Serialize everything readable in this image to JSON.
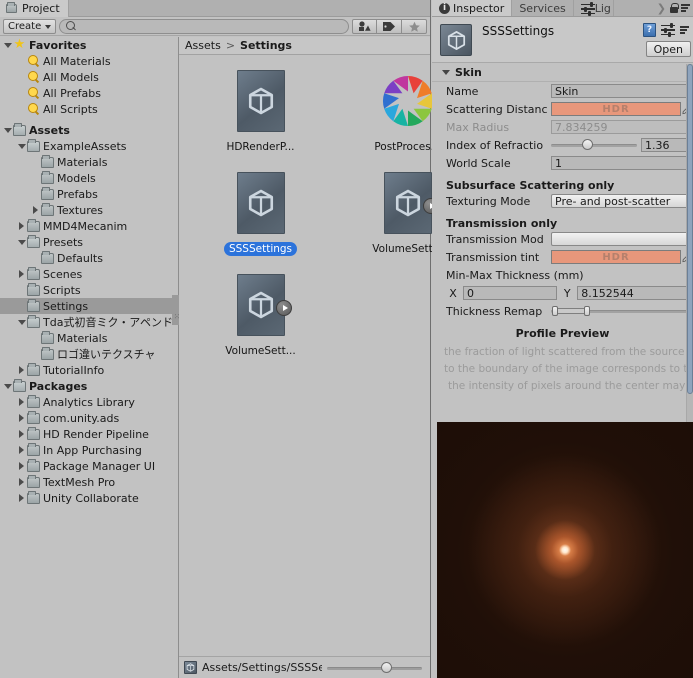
{
  "project_window": {
    "tabs": [
      {
        "label": "Project",
        "icon": "folder-icon",
        "active": true
      }
    ],
    "toolbar": {
      "create_label": "Create",
      "search_placeholder": "",
      "search_value": "",
      "filters": [
        {
          "name": "filter-by-type-icon"
        },
        {
          "name": "filter-by-label-icon"
        },
        {
          "name": "filter-favorites-star-icon"
        }
      ]
    },
    "tree": [
      {
        "label": "Favorites",
        "depth": 0,
        "icon": "star-icon",
        "twisty": "down",
        "bold": true,
        "selected": false
      },
      {
        "label": "All Materials",
        "depth": 1,
        "icon": "search-lens-icon",
        "twisty": "none",
        "bold": false,
        "selected": false
      },
      {
        "label": "All Models",
        "depth": 1,
        "icon": "search-lens-icon",
        "twisty": "none",
        "bold": false,
        "selected": false
      },
      {
        "label": "All Prefabs",
        "depth": 1,
        "icon": "search-lens-icon",
        "twisty": "none",
        "bold": false,
        "selected": false
      },
      {
        "label": "All Scripts",
        "depth": 1,
        "icon": "search-lens-icon",
        "twisty": "none",
        "bold": false,
        "selected": false
      },
      {
        "label": "",
        "depth": 0,
        "icon": "none",
        "twisty": "none",
        "bold": false,
        "selected": false
      },
      {
        "label": "Assets",
        "depth": 0,
        "icon": "folder-icon",
        "twisty": "down",
        "bold": true,
        "selected": false
      },
      {
        "label": "ExampleAssets",
        "depth": 1,
        "icon": "folder-icon",
        "twisty": "down",
        "bold": false,
        "selected": false
      },
      {
        "label": "Materials",
        "depth": 2,
        "icon": "folder-icon",
        "twisty": "none",
        "bold": false,
        "selected": false
      },
      {
        "label": "Models",
        "depth": 2,
        "icon": "folder-icon",
        "twisty": "none",
        "bold": false,
        "selected": false
      },
      {
        "label": "Prefabs",
        "depth": 2,
        "icon": "folder-icon",
        "twisty": "none",
        "bold": false,
        "selected": false
      },
      {
        "label": "Textures",
        "depth": 2,
        "icon": "folder-icon",
        "twisty": "right",
        "bold": false,
        "selected": false
      },
      {
        "label": "MMD4Mecanim",
        "depth": 1,
        "icon": "folder-icon",
        "twisty": "right",
        "bold": false,
        "selected": false
      },
      {
        "label": "Presets",
        "depth": 1,
        "icon": "folder-icon",
        "twisty": "down",
        "bold": false,
        "selected": false
      },
      {
        "label": "Defaults",
        "depth": 2,
        "icon": "folder-icon",
        "twisty": "none",
        "bold": false,
        "selected": false
      },
      {
        "label": "Scenes",
        "depth": 1,
        "icon": "folder-icon",
        "twisty": "right",
        "bold": false,
        "selected": false
      },
      {
        "label": "Scripts",
        "depth": 1,
        "icon": "folder-icon",
        "twisty": "none",
        "bold": false,
        "selected": false
      },
      {
        "label": "Settings",
        "depth": 1,
        "icon": "folder-icon",
        "twisty": "none",
        "bold": false,
        "selected": true
      },
      {
        "label": "Tda式初音ミク・アペンド",
        "depth": 1,
        "icon": "folder-icon",
        "twisty": "down",
        "bold": false,
        "selected": false
      },
      {
        "label": "Materials",
        "depth": 2,
        "icon": "folder-icon",
        "twisty": "none",
        "bold": false,
        "selected": false
      },
      {
        "label": "ロゴ違いテクスチャ",
        "depth": 2,
        "icon": "folder-icon",
        "twisty": "none",
        "bold": false,
        "selected": false
      },
      {
        "label": "TutorialInfo",
        "depth": 1,
        "icon": "folder-icon",
        "twisty": "right",
        "bold": false,
        "selected": false
      },
      {
        "label": "Packages",
        "depth": 0,
        "icon": "folder-icon",
        "twisty": "down",
        "bold": true,
        "selected": false
      },
      {
        "label": "Analytics Library",
        "depth": 1,
        "icon": "folder-icon",
        "twisty": "right",
        "bold": false,
        "selected": false
      },
      {
        "label": "com.unity.ads",
        "depth": 1,
        "icon": "folder-icon",
        "twisty": "right",
        "bold": false,
        "selected": false
      },
      {
        "label": "HD Render Pipeline",
        "depth": 1,
        "icon": "folder-icon",
        "twisty": "right",
        "bold": false,
        "selected": false
      },
      {
        "label": "In App Purchasing",
        "depth": 1,
        "icon": "folder-icon",
        "twisty": "right",
        "bold": false,
        "selected": false
      },
      {
        "label": "Package Manager UI",
        "depth": 1,
        "icon": "folder-icon",
        "twisty": "right",
        "bold": false,
        "selected": false
      },
      {
        "label": "TextMesh Pro",
        "depth": 1,
        "icon": "folder-icon",
        "twisty": "right",
        "bold": false,
        "selected": false
      },
      {
        "label": "Unity Collaborate",
        "depth": 1,
        "icon": "folder-icon",
        "twisty": "right",
        "bold": false,
        "selected": false
      }
    ],
    "breadcrumb": {
      "root": "Assets",
      "separator": ">",
      "current": "Settings"
    },
    "assets": [
      {
        "label": "HDRenderP...",
        "icon": "unity-asset-icon",
        "selected": false,
        "has_play_badge": false
      },
      {
        "label": "PostProces...",
        "icon": "post-processing-aperture-icon",
        "selected": false,
        "has_play_badge": false
      },
      {
        "label": "SSSSettings",
        "icon": "unity-asset-icon",
        "selected": true,
        "has_play_badge": false
      },
      {
        "label": "VolumeSett...",
        "icon": "unity-asset-icon",
        "selected": false,
        "has_play_badge": true
      },
      {
        "label": "VolumeSett...",
        "icon": "unity-asset-icon",
        "selected": false,
        "has_play_badge": true
      }
    ],
    "status_bar": {
      "path": "Assets/Settings/SSSSettin",
      "zoom_value": 62
    }
  },
  "inspector_window": {
    "tabs": [
      {
        "label": "Inspector",
        "icon": "info-icon",
        "active": true
      },
      {
        "label": "Services",
        "icon": "none",
        "active": false
      },
      {
        "label": "Lig",
        "icon": "lighting-icon",
        "active": false
      }
    ],
    "lock_icon": "lock-icon",
    "menu_icon": "hamburger-menu-icon",
    "header": {
      "title": "SSSSettings",
      "asset_icon": "unity-asset-icon",
      "help_icon": "help-book-icon",
      "preset_icon": "preset-sliders-icon",
      "open_button": "Open"
    },
    "sections": [
      {
        "name": "Skin",
        "expanded": true,
        "fields": [
          {
            "type": "text",
            "label": "Name",
            "value": "Skin",
            "style": "normal"
          },
          {
            "type": "color",
            "label": "Scattering Distanc",
            "value": "HDR",
            "color": "#e8977b"
          },
          {
            "type": "text",
            "label": "Max Radius",
            "value": "7.834259",
            "style": "readonly"
          },
          {
            "type": "slider",
            "label": "Index of Refractio",
            "value": "1.36",
            "fraction": 0.42
          },
          {
            "type": "text",
            "label": "World Scale",
            "value": "1",
            "style": "normal"
          }
        ]
      }
    ],
    "sub_headers": {
      "sss_only": "Subsurface Scattering only",
      "transmission_only": "Transmission only"
    },
    "sss_fields": [
      {
        "type": "dropdown",
        "label": "Texturing Mode",
        "value": "Pre- and post-scatter"
      }
    ],
    "transmission_fields": [
      {
        "type": "dropdown",
        "label": "Transmission Mod",
        "value": ""
      },
      {
        "type": "color",
        "label": "Transmission tint",
        "value": "HDR",
        "color": "#e8977b"
      }
    ],
    "thickness": {
      "title": "Min-Max Thickness (mm)",
      "x_axis": "X",
      "x_value": "0",
      "y_axis": "Y",
      "y_value": "8.152544",
      "remap_label": "Thickness Remap"
    },
    "profile_preview": {
      "title": "Profile Preview",
      "lines": [
        "the fraction of light scattered from the source",
        "to the boundary of the image corresponds to th",
        "the intensity of pixels around the center may"
      ]
    }
  },
  "colors": {
    "window_bg": "#c2c2c2",
    "selection_blue": "#2c73db",
    "tree_selected": "#9a9a9a",
    "hdr_swatch": "#e8977b",
    "scroll_thumb": "#8fa4bd"
  }
}
